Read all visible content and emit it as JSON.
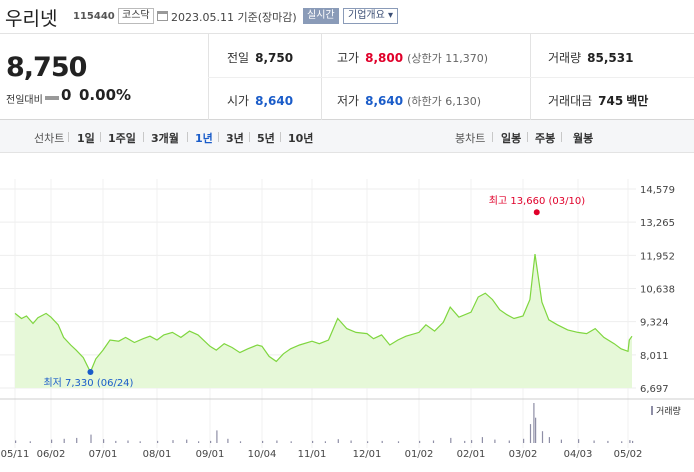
{
  "header": {
    "name": "우리넷",
    "code": "115440",
    "market": "코스닥",
    "date_text": "2023.05.11  기준(장마감)",
    "realtime_label": "실시간",
    "company_button": "기업개요 ▾"
  },
  "price": {
    "current": "8,750",
    "change_label": "전일대비",
    "change_value": "0",
    "change_rate": "0.00%"
  },
  "stats": {
    "prev_close": {
      "label": "전일",
      "value": "8,750"
    },
    "high": {
      "label": "고가",
      "value": "8,800",
      "limit": "(상한가 11,370)"
    },
    "volume": {
      "label": "거래량",
      "value": "85,531"
    },
    "open": {
      "label": "시가",
      "value": "8,640"
    },
    "low": {
      "label": "저가",
      "value": "8,640",
      "limit": "(하한가 6,130)"
    },
    "amount": {
      "label": "거래대금",
      "value": "745",
      "unit": "백만"
    }
  },
  "tabs": {
    "line_label": "선차트",
    "periods": [
      "1일",
      "1주일",
      "3개월",
      "1년",
      "3년",
      "5년",
      "10년"
    ],
    "active_period": "1년",
    "candle_label": "봉차트",
    "candles": [
      "일봉",
      "주봉",
      "월봉"
    ]
  },
  "colors": {
    "line": "#7fd63f",
    "fill": "#e6f8d8",
    "up": "#e0002a",
    "down": "#1a5cc9",
    "volume_bar": "#8e8ea6"
  },
  "chart_data": {
    "type": "area",
    "x_tick_labels": [
      "05/11",
      "06/02",
      "07/01",
      "08/01",
      "09/01",
      "10/04",
      "11/01",
      "12/01",
      "01/02",
      "02/01",
      "03/02",
      "04/03",
      "05/02"
    ],
    "y_ticks": [
      "14,579",
      "13,265",
      "11,952",
      "10,638",
      "9,324",
      "8,011",
      "6,697"
    ],
    "ylim": [
      6697,
      14579
    ],
    "max_annotation": "최고 13,660 (03/10)",
    "min_annotation": "최저 7,330 (06/24)",
    "max_point": {
      "date": "03/10",
      "value": 13660
    },
    "min_point": {
      "date": "06/24",
      "value": 7330
    },
    "volume_legend": "거래량",
    "price_series": [
      {
        "x": "05/11",
        "y": 9650
      },
      {
        "x": "05/15",
        "y": 9450
      },
      {
        "x": "05/18",
        "y": 9550
      },
      {
        "x": "05/22",
        "y": 9250
      },
      {
        "x": "05/25",
        "y": 9480
      },
      {
        "x": "05/30",
        "y": 9650
      },
      {
        "x": "06/02",
        "y": 9500
      },
      {
        "x": "06/06",
        "y": 9200
      },
      {
        "x": "06/09",
        "y": 8700
      },
      {
        "x": "06/13",
        "y": 8400
      },
      {
        "x": "06/16",
        "y": 8200
      },
      {
        "x": "06/20",
        "y": 7900
      },
      {
        "x": "06/24",
        "y": 7330
      },
      {
        "x": "06/27",
        "y": 7850
      },
      {
        "x": "07/01",
        "y": 8200
      },
      {
        "x": "07/05",
        "y": 8600
      },
      {
        "x": "07/10",
        "y": 8550
      },
      {
        "x": "07/14",
        "y": 8700
      },
      {
        "x": "07/19",
        "y": 8500
      },
      {
        "x": "07/24",
        "y": 8650
      },
      {
        "x": "07/28",
        "y": 8750
      },
      {
        "x": "08/01",
        "y": 8600
      },
      {
        "x": "08/05",
        "y": 8800
      },
      {
        "x": "08/10",
        "y": 8900
      },
      {
        "x": "08/15",
        "y": 8700
      },
      {
        "x": "08/20",
        "y": 8950
      },
      {
        "x": "08/25",
        "y": 8800
      },
      {
        "x": "09/01",
        "y": 8350
      },
      {
        "x": "09/05",
        "y": 8200
      },
      {
        "x": "09/10",
        "y": 8450
      },
      {
        "x": "09/15",
        "y": 8300
      },
      {
        "x": "09/20",
        "y": 8100
      },
      {
        "x": "09/25",
        "y": 8250
      },
      {
        "x": "10/01",
        "y": 8400
      },
      {
        "x": "10/04",
        "y": 8350
      },
      {
        "x": "10/08",
        "y": 7950
      },
      {
        "x": "10/12",
        "y": 7750
      },
      {
        "x": "10/16",
        "y": 8050
      },
      {
        "x": "10/20",
        "y": 8250
      },
      {
        "x": "10/25",
        "y": 8400
      },
      {
        "x": "11/01",
        "y": 8550
      },
      {
        "x": "11/05",
        "y": 8450
      },
      {
        "x": "11/10",
        "y": 8600
      },
      {
        "x": "11/15",
        "y": 9450
      },
      {
        "x": "11/20",
        "y": 9050
      },
      {
        "x": "11/25",
        "y": 8900
      },
      {
        "x": "12/01",
        "y": 8850
      },
      {
        "x": "12/05",
        "y": 8650
      },
      {
        "x": "12/10",
        "y": 8800
      },
      {
        "x": "12/15",
        "y": 8400
      },
      {
        "x": "12/20",
        "y": 8600
      },
      {
        "x": "12/25",
        "y": 8750
      },
      {
        "x": "01/02",
        "y": 8900
      },
      {
        "x": "01/06",
        "y": 9200
      },
      {
        "x": "01/11",
        "y": 8950
      },
      {
        "x": "01/16",
        "y": 9300
      },
      {
        "x": "01/20",
        "y": 9900
      },
      {
        "x": "01/25",
        "y": 9500
      },
      {
        "x": "02/01",
        "y": 9700
      },
      {
        "x": "02/05",
        "y": 10300
      },
      {
        "x": "02/09",
        "y": 10450
      },
      {
        "x": "02/13",
        "y": 10200
      },
      {
        "x": "02/17",
        "y": 9800
      },
      {
        "x": "02/21",
        "y": 9600
      },
      {
        "x": "02/25",
        "y": 9450
      },
      {
        "x": "03/02",
        "y": 9550
      },
      {
        "x": "03/06",
        "y": 10200
      },
      {
        "x": "03/09",
        "y": 12000
      },
      {
        "x": "03/13",
        "y": 10100
      },
      {
        "x": "03/17",
        "y": 9400
      },
      {
        "x": "03/22",
        "y": 9200
      },
      {
        "x": "03/28",
        "y": 9000
      },
      {
        "x": "04/03",
        "y": 8900
      },
      {
        "x": "04/08",
        "y": 8850
      },
      {
        "x": "04/13",
        "y": 9050
      },
      {
        "x": "04/18",
        "y": 8700
      },
      {
        "x": "04/24",
        "y": 8450
      },
      {
        "x": "04/28",
        "y": 8250
      },
      {
        "x": "05/02",
        "y": 8150
      },
      {
        "x": "05/05",
        "y": 8600
      },
      {
        "x": "05/11",
        "y": 8750
      }
    ],
    "volume_bars": [
      {
        "x": "05/11",
        "v": 6
      },
      {
        "x": "05/20",
        "v": 4
      },
      {
        "x": "06/02",
        "v": 8
      },
      {
        "x": "06/09",
        "v": 10
      },
      {
        "x": "06/16",
        "v": 12
      },
      {
        "x": "06/24",
        "v": 20
      },
      {
        "x": "07/01",
        "v": 9
      },
      {
        "x": "07/08",
        "v": 5
      },
      {
        "x": "07/15",
        "v": 6
      },
      {
        "x": "07/22",
        "v": 4
      },
      {
        "x": "08/01",
        "v": 5
      },
      {
        "x": "08/10",
        "v": 7
      },
      {
        "x": "08/18",
        "v": 8
      },
      {
        "x": "08/25",
        "v": 4
      },
      {
        "x": "09/01",
        "v": 5
      },
      {
        "x": "09/05",
        "v": 30
      },
      {
        "x": "09/12",
        "v": 10
      },
      {
        "x": "09/20",
        "v": 4
      },
      {
        "x": "10/04",
        "v": 5
      },
      {
        "x": "10/12",
        "v": 6
      },
      {
        "x": "10/20",
        "v": 4
      },
      {
        "x": "11/01",
        "v": 5
      },
      {
        "x": "11/08",
        "v": 4
      },
      {
        "x": "11/15",
        "v": 9
      },
      {
        "x": "11/22",
        "v": 6
      },
      {
        "x": "12/01",
        "v": 4
      },
      {
        "x": "12/10",
        "v": 5
      },
      {
        "x": "12/20",
        "v": 4
      },
      {
        "x": "01/02",
        "v": 5
      },
      {
        "x": "01/10",
        "v": 6
      },
      {
        "x": "01/20",
        "v": 12
      },
      {
        "x": "01/28",
        "v": 5
      },
      {
        "x": "02/01",
        "v": 7
      },
      {
        "x": "02/07",
        "v": 14
      },
      {
        "x": "02/14",
        "v": 8
      },
      {
        "x": "02/22",
        "v": 6
      },
      {
        "x": "03/02",
        "v": 10
      },
      {
        "x": "03/06",
        "v": 45
      },
      {
        "x": "03/08",
        "v": 95
      },
      {
        "x": "03/09",
        "v": 60
      },
      {
        "x": "03/13",
        "v": 28
      },
      {
        "x": "03/17",
        "v": 14
      },
      {
        "x": "03/24",
        "v": 8
      },
      {
        "x": "04/03",
        "v": 9
      },
      {
        "x": "04/12",
        "v": 6
      },
      {
        "x": "04/20",
        "v": 5
      },
      {
        "x": "04/28",
        "v": 4
      },
      {
        "x": "05/05",
        "v": 7
      },
      {
        "x": "05/11",
        "v": 5
      }
    ]
  }
}
